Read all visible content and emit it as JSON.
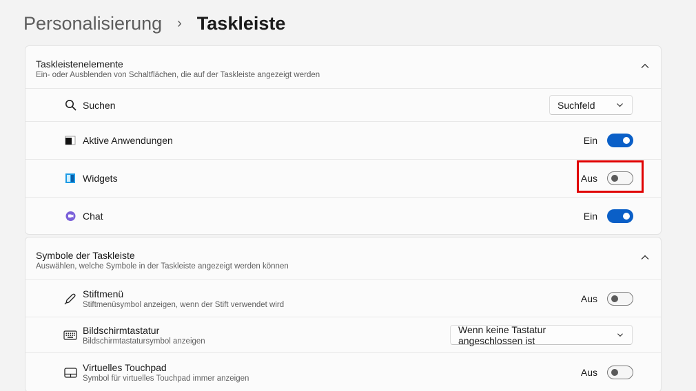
{
  "breadcrumb": {
    "parent": "Personalisierung",
    "separator": "›",
    "current": "Taskleiste"
  },
  "section1": {
    "title": "Taskleistenelemente",
    "subtitle": "Ein- oder Ausblenden von Schaltflächen, die auf der Taskleiste angezeigt werden",
    "items": [
      {
        "label": "Suchen",
        "icon": "search-icon",
        "control": "dropdown",
        "value": "Suchfeld"
      },
      {
        "label": "Aktive Anwendungen",
        "icon": "task-view-icon",
        "control": "toggle",
        "state": "Ein"
      },
      {
        "label": "Widgets",
        "icon": "widgets-icon",
        "control": "toggle",
        "state": "Aus"
      },
      {
        "label": "Chat",
        "icon": "chat-icon",
        "control": "toggle",
        "state": "Ein"
      }
    ]
  },
  "section2": {
    "title": "Symbole der Taskleiste",
    "subtitle": "Auswählen, welche Symbole in der Taskleiste angezeigt werden können",
    "items": [
      {
        "label": "Stiftmenü",
        "desc": "Stiftmenüsymbol anzeigen, wenn der Stift verwendet wird",
        "icon": "pen-icon",
        "control": "toggle",
        "state": "Aus"
      },
      {
        "label": "Bildschirmtastatur",
        "desc": "Bildschirmtastatursymbol anzeigen",
        "icon": "keyboard-icon",
        "control": "dropdown",
        "value": "Wenn keine Tastatur angeschlossen ist"
      },
      {
        "label": "Virtuelles Touchpad",
        "desc": "Symbol für virtuelles Touchpad immer anzeigen",
        "icon": "touchpad-icon",
        "control": "toggle",
        "state": "Aus"
      }
    ]
  },
  "colors": {
    "accent": "#0a5fc7",
    "highlight": "#e00000"
  }
}
